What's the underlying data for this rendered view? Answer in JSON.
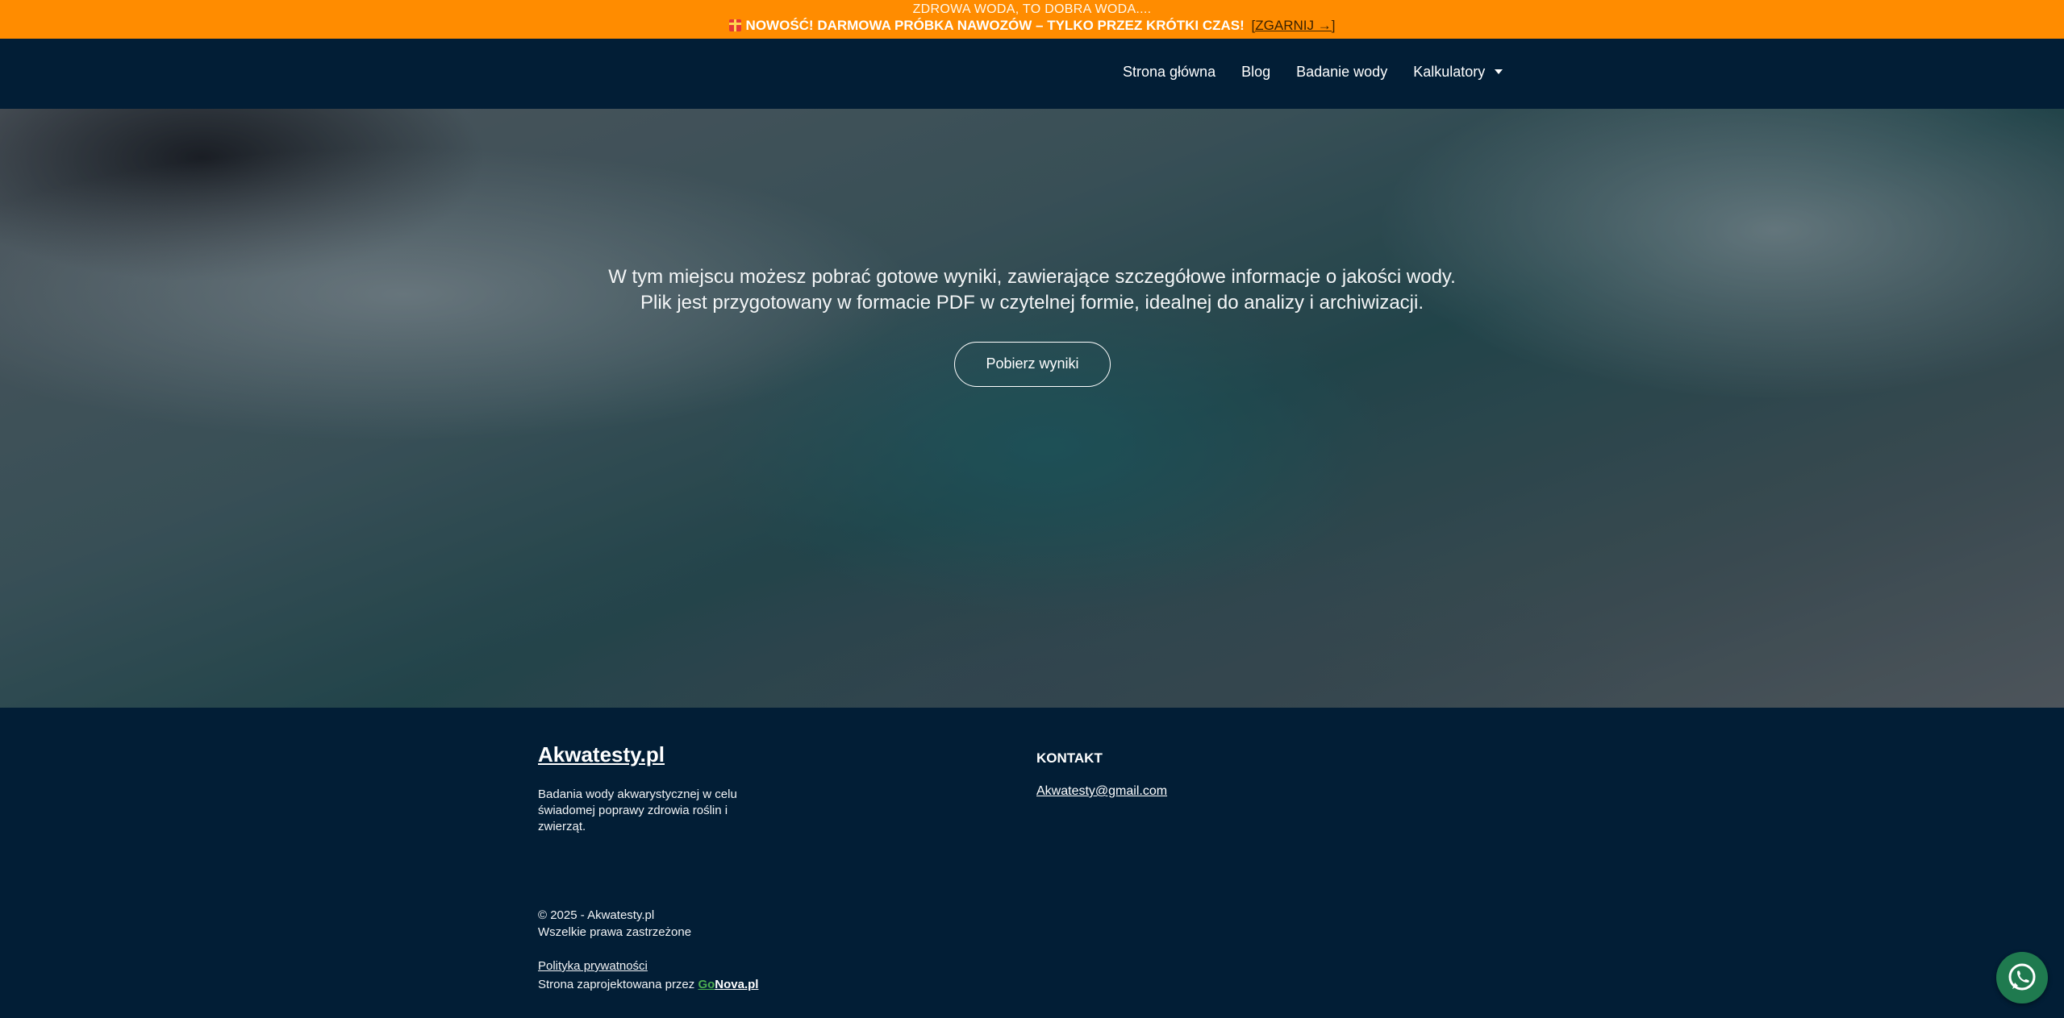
{
  "promo": {
    "line1": "ZDROWA WODA, TO DOBRA WODA....",
    "line2": "NOWOŚĆ! DARMOWA PRÓBKA NAWOZÓW – TYLKO PRZEZ KRÓTKI CZAS!",
    "link": "[ZGARNIJ →]",
    "gift_icon": "gift-icon",
    "bg_color": "#ff8c00"
  },
  "nav": {
    "items": [
      {
        "label": "Strona główna"
      },
      {
        "label": "Blog"
      },
      {
        "label": "Badanie wody"
      },
      {
        "label": "Kalkulatory"
      }
    ],
    "bg_color": "#021e36"
  },
  "hero": {
    "line1": "W tym miejscu możesz pobrać gotowe wyniki, zawierające szczegółowe informacje o jakości wody.",
    "line2": "Plik jest przygotowany w formacie PDF w czytelnej formie, idealnej do analizy i archiwizacji.",
    "button_label": "Pobierz wyniki"
  },
  "footer": {
    "brand": "Akwatesty.pl",
    "description": "Badania wody akwarystycznej w celu świadomej poprawy zdrowia roślin i zwierząt.",
    "contact_heading": "KONTAKT",
    "contact_email": "Akwatesty@gmail.com",
    "copyright_line1": "© 2025 - Akwatesty.pl",
    "copyright_line2": "Wszelkie prawa zastrzeżone",
    "privacy_policy": "Polityka prywatności",
    "designed_by": "Strona zaprojektowana przez ",
    "designer_part1": "Go",
    "designer_part2": "Nova.pl"
  },
  "whatsapp": {
    "icon": "whatsapp-icon",
    "color": "#1f7a4f"
  }
}
